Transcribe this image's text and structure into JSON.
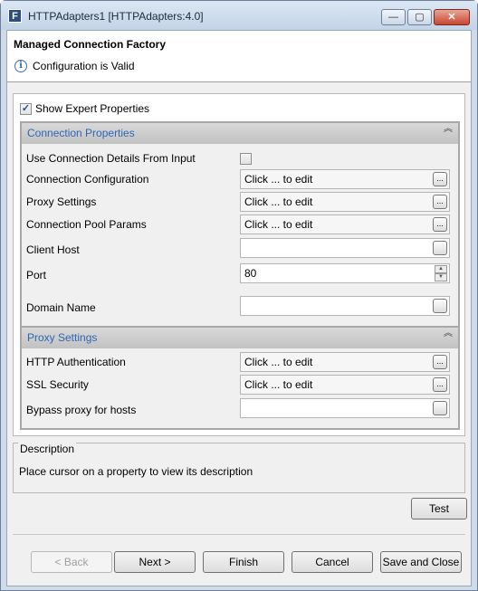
{
  "window": {
    "title": "HTTPAdapters1 [HTTPAdapters:4.0]",
    "icon_letter": "F",
    "minimize_glyph": "—",
    "maximize_glyph": "▢",
    "close_glyph": "✕"
  },
  "header": {
    "title": "Managed Connection Factory",
    "status": "Configuration is Valid",
    "info_glyph": "i"
  },
  "expert": {
    "label": "Show Expert Properties",
    "checked": true,
    "check_glyph": "✓"
  },
  "sections": {
    "connection": {
      "title": "Connection Properties",
      "rows": {
        "use_details": {
          "label": "Use Connection Details From Input",
          "checked": false
        },
        "connection_config": {
          "label": "Connection Configuration",
          "value": "Click ... to edit"
        },
        "proxy_settings": {
          "label": "Proxy Settings",
          "value": "Click ... to edit"
        },
        "pool_params": {
          "label": "Connection Pool Params",
          "value": "Click ... to edit"
        },
        "client_host": {
          "label": "Client Host",
          "value": ""
        },
        "port": {
          "label": "Port",
          "value": "80"
        },
        "domain_name": {
          "label": "Domain Name",
          "value": ""
        }
      }
    },
    "proxy": {
      "title": "Proxy Settings",
      "rows": {
        "http_auth": {
          "label": "HTTP Authentication",
          "value": "Click ... to edit"
        },
        "ssl_security": {
          "label": "SSL Security",
          "value": "Click ... to edit"
        },
        "bypass_hosts": {
          "label": "Bypass proxy for hosts",
          "value": ""
        }
      }
    }
  },
  "collapse_glyph": "︽",
  "ellipsis_glyph": "...",
  "spin_up": "▲",
  "spin_down": "▼",
  "description": {
    "legend": "Description",
    "text": "Place cursor on a property to view its description"
  },
  "buttons": {
    "test": "Test",
    "back": "< Back",
    "next": "Next >",
    "finish": "Finish",
    "cancel": "Cancel",
    "save_close": "Save and Close"
  }
}
